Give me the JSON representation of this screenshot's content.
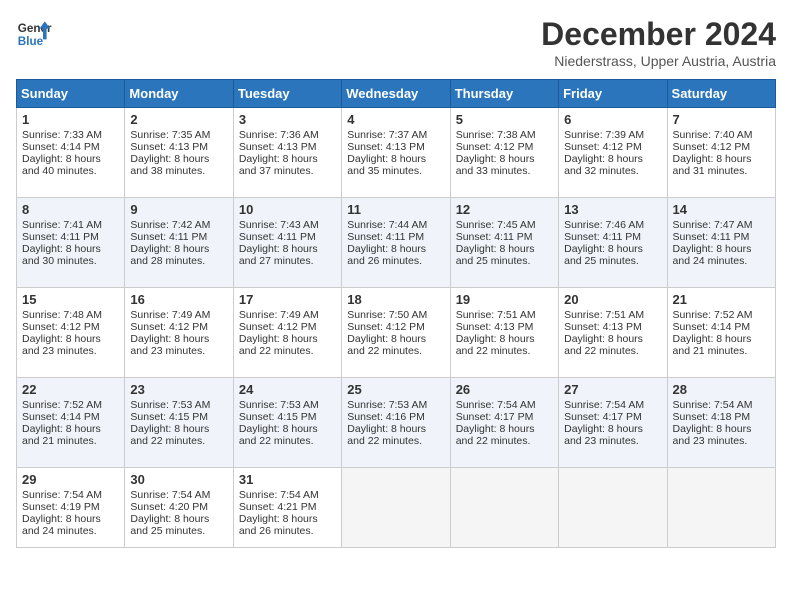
{
  "header": {
    "logo_line1": "General",
    "logo_line2": "Blue",
    "title": "December 2024",
    "subtitle": "Niederstrass, Upper Austria, Austria"
  },
  "days_of_week": [
    "Sunday",
    "Monday",
    "Tuesday",
    "Wednesday",
    "Thursday",
    "Friday",
    "Saturday"
  ],
  "weeks": [
    [
      {
        "day": "1",
        "lines": [
          "Sunrise: 7:33 AM",
          "Sunset: 4:14 PM",
          "Daylight: 8 hours",
          "and 40 minutes."
        ]
      },
      {
        "day": "2",
        "lines": [
          "Sunrise: 7:35 AM",
          "Sunset: 4:13 PM",
          "Daylight: 8 hours",
          "and 38 minutes."
        ]
      },
      {
        "day": "3",
        "lines": [
          "Sunrise: 7:36 AM",
          "Sunset: 4:13 PM",
          "Daylight: 8 hours",
          "and 37 minutes."
        ]
      },
      {
        "day": "4",
        "lines": [
          "Sunrise: 7:37 AM",
          "Sunset: 4:13 PM",
          "Daylight: 8 hours",
          "and 35 minutes."
        ]
      },
      {
        "day": "5",
        "lines": [
          "Sunrise: 7:38 AM",
          "Sunset: 4:12 PM",
          "Daylight: 8 hours",
          "and 33 minutes."
        ]
      },
      {
        "day": "6",
        "lines": [
          "Sunrise: 7:39 AM",
          "Sunset: 4:12 PM",
          "Daylight: 8 hours",
          "and 32 minutes."
        ]
      },
      {
        "day": "7",
        "lines": [
          "Sunrise: 7:40 AM",
          "Sunset: 4:12 PM",
          "Daylight: 8 hours",
          "and 31 minutes."
        ]
      }
    ],
    [
      {
        "day": "8",
        "lines": [
          "Sunrise: 7:41 AM",
          "Sunset: 4:11 PM",
          "Daylight: 8 hours",
          "and 30 minutes."
        ]
      },
      {
        "day": "9",
        "lines": [
          "Sunrise: 7:42 AM",
          "Sunset: 4:11 PM",
          "Daylight: 8 hours",
          "and 28 minutes."
        ]
      },
      {
        "day": "10",
        "lines": [
          "Sunrise: 7:43 AM",
          "Sunset: 4:11 PM",
          "Daylight: 8 hours",
          "and 27 minutes."
        ]
      },
      {
        "day": "11",
        "lines": [
          "Sunrise: 7:44 AM",
          "Sunset: 4:11 PM",
          "Daylight: 8 hours",
          "and 26 minutes."
        ]
      },
      {
        "day": "12",
        "lines": [
          "Sunrise: 7:45 AM",
          "Sunset: 4:11 PM",
          "Daylight: 8 hours",
          "and 25 minutes."
        ]
      },
      {
        "day": "13",
        "lines": [
          "Sunrise: 7:46 AM",
          "Sunset: 4:11 PM",
          "Daylight: 8 hours",
          "and 25 minutes."
        ]
      },
      {
        "day": "14",
        "lines": [
          "Sunrise: 7:47 AM",
          "Sunset: 4:11 PM",
          "Daylight: 8 hours",
          "and 24 minutes."
        ]
      }
    ],
    [
      {
        "day": "15",
        "lines": [
          "Sunrise: 7:48 AM",
          "Sunset: 4:12 PM",
          "Daylight: 8 hours",
          "and 23 minutes."
        ]
      },
      {
        "day": "16",
        "lines": [
          "Sunrise: 7:49 AM",
          "Sunset: 4:12 PM",
          "Daylight: 8 hours",
          "and 23 minutes."
        ]
      },
      {
        "day": "17",
        "lines": [
          "Sunrise: 7:49 AM",
          "Sunset: 4:12 PM",
          "Daylight: 8 hours",
          "and 22 minutes."
        ]
      },
      {
        "day": "18",
        "lines": [
          "Sunrise: 7:50 AM",
          "Sunset: 4:12 PM",
          "Daylight: 8 hours",
          "and 22 minutes."
        ]
      },
      {
        "day": "19",
        "lines": [
          "Sunrise: 7:51 AM",
          "Sunset: 4:13 PM",
          "Daylight: 8 hours",
          "and 22 minutes."
        ]
      },
      {
        "day": "20",
        "lines": [
          "Sunrise: 7:51 AM",
          "Sunset: 4:13 PM",
          "Daylight: 8 hours",
          "and 22 minutes."
        ]
      },
      {
        "day": "21",
        "lines": [
          "Sunrise: 7:52 AM",
          "Sunset: 4:14 PM",
          "Daylight: 8 hours",
          "and 21 minutes."
        ]
      }
    ],
    [
      {
        "day": "22",
        "lines": [
          "Sunrise: 7:52 AM",
          "Sunset: 4:14 PM",
          "Daylight: 8 hours",
          "and 21 minutes."
        ]
      },
      {
        "day": "23",
        "lines": [
          "Sunrise: 7:53 AM",
          "Sunset: 4:15 PM",
          "Daylight: 8 hours",
          "and 22 minutes."
        ]
      },
      {
        "day": "24",
        "lines": [
          "Sunrise: 7:53 AM",
          "Sunset: 4:15 PM",
          "Daylight: 8 hours",
          "and 22 minutes."
        ]
      },
      {
        "day": "25",
        "lines": [
          "Sunrise: 7:53 AM",
          "Sunset: 4:16 PM",
          "Daylight: 8 hours",
          "and 22 minutes."
        ]
      },
      {
        "day": "26",
        "lines": [
          "Sunrise: 7:54 AM",
          "Sunset: 4:17 PM",
          "Daylight: 8 hours",
          "and 22 minutes."
        ]
      },
      {
        "day": "27",
        "lines": [
          "Sunrise: 7:54 AM",
          "Sunset: 4:17 PM",
          "Daylight: 8 hours",
          "and 23 minutes."
        ]
      },
      {
        "day": "28",
        "lines": [
          "Sunrise: 7:54 AM",
          "Sunset: 4:18 PM",
          "Daylight: 8 hours",
          "and 23 minutes."
        ]
      }
    ],
    [
      {
        "day": "29",
        "lines": [
          "Sunrise: 7:54 AM",
          "Sunset: 4:19 PM",
          "Daylight: 8 hours",
          "and 24 minutes."
        ]
      },
      {
        "day": "30",
        "lines": [
          "Sunrise: 7:54 AM",
          "Sunset: 4:20 PM",
          "Daylight: 8 hours",
          "and 25 minutes."
        ]
      },
      {
        "day": "31",
        "lines": [
          "Sunrise: 7:54 AM",
          "Sunset: 4:21 PM",
          "Daylight: 8 hours",
          "and 26 minutes."
        ]
      },
      null,
      null,
      null,
      null
    ]
  ]
}
